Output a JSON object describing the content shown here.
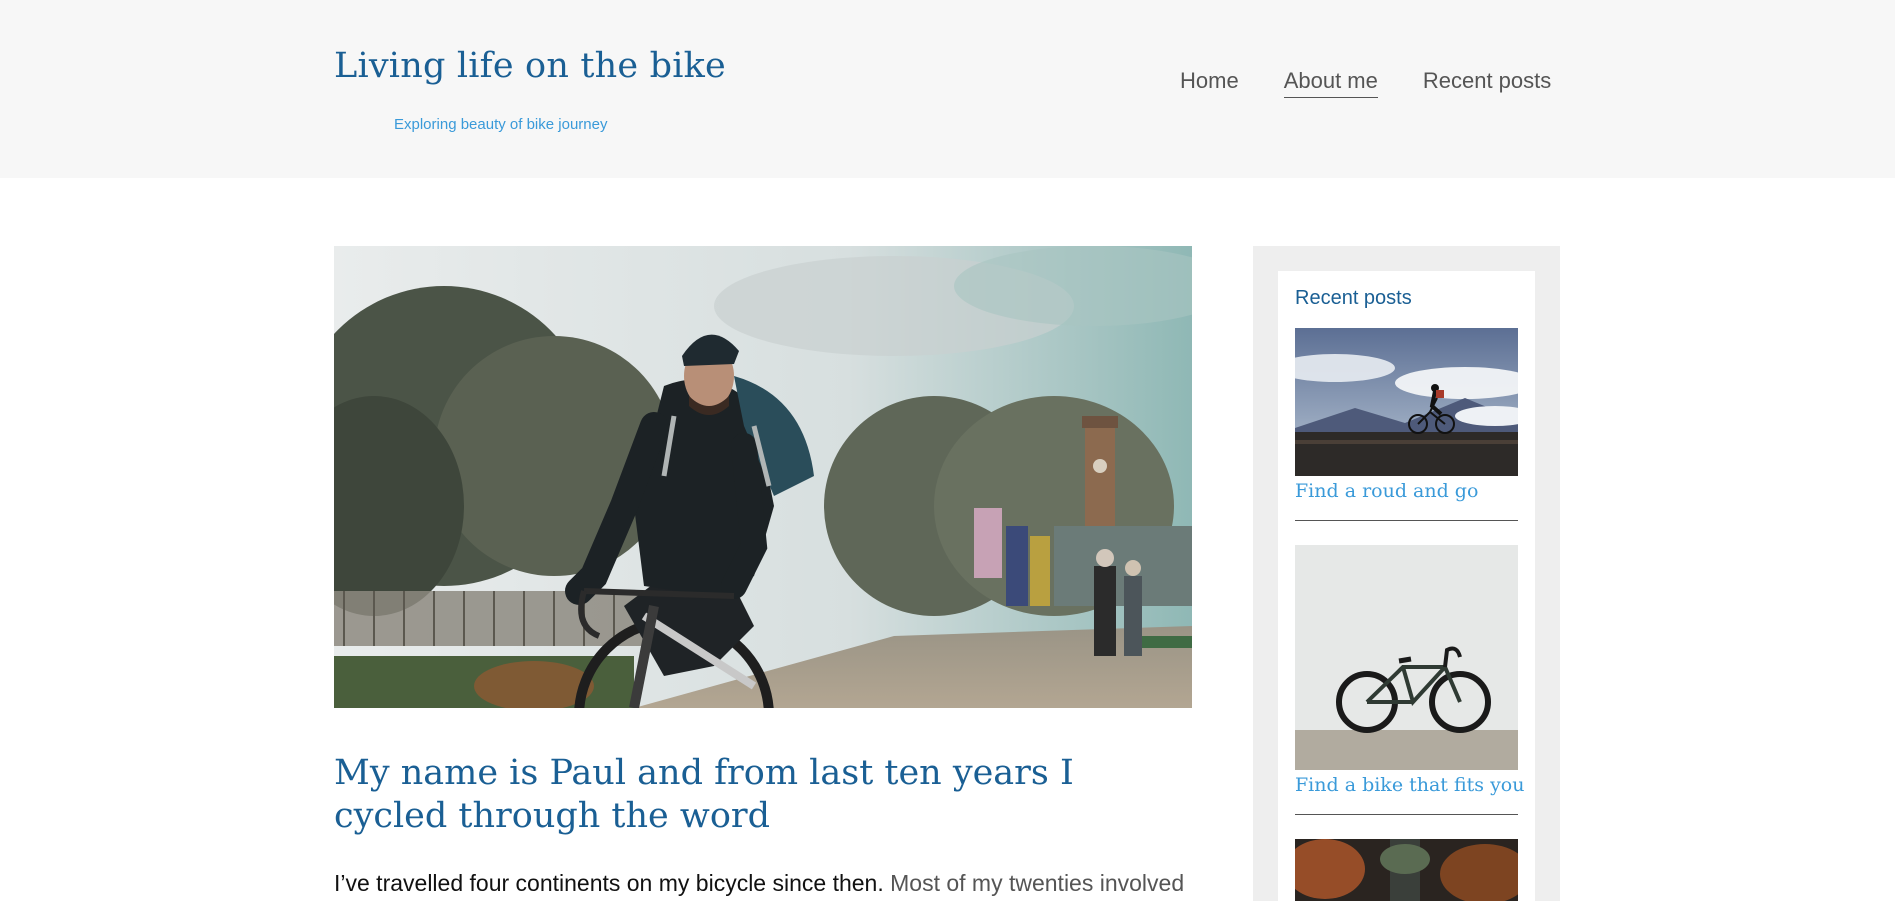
{
  "site": {
    "title": "Living life on the bike",
    "tagline": "Exploring beauty of bike journey"
  },
  "nav": {
    "items": [
      {
        "label": "Home",
        "active": false
      },
      {
        "label": "About me",
        "active": true
      },
      {
        "label": "Recent posts",
        "active": false
      }
    ]
  },
  "hero": {
    "image": "cyclist riding road bike in park with clock tower"
  },
  "post": {
    "title": "My name is Paul and from last ten years I cycled through the word",
    "lead_bold": "I’ve travelled four continents on my bicycle since then.",
    "lead_rest": " Most of my twenties involved"
  },
  "sidebar": {
    "widget_title": "Recent posts",
    "posts": [
      {
        "title": "Find a roud and go",
        "image": "cyclist silhouette on mountain road above clouds"
      },
      {
        "title": "Find a bike that fits you",
        "image": "road bike against white wall"
      },
      {
        "title": "",
        "image": "autumn forest road"
      }
    ]
  },
  "colors": {
    "brand_blue": "#1a5f94",
    "link_blue": "#3a9ad9",
    "header_bg": "#f7f7f7",
    "sidebar_bg": "#eeeeee"
  }
}
